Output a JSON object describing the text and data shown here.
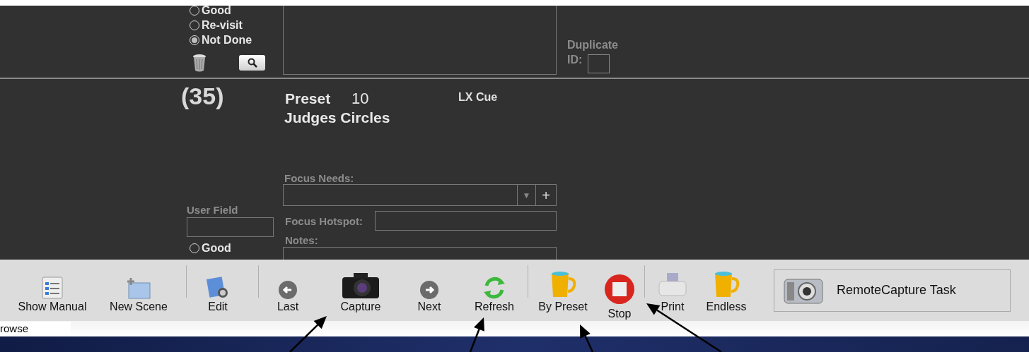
{
  "record_top": {
    "radios": [
      {
        "label": "Good",
        "selected": false
      },
      {
        "label": "Re-visit",
        "selected": false
      },
      {
        "label": "Not Done",
        "selected": true
      }
    ],
    "duplicate_label": "Duplicate",
    "id_label": "ID:"
  },
  "record": {
    "number": "(35)",
    "preset_label": "Preset",
    "preset_value": "10",
    "name": "Judges Circles",
    "lx_cue_label": "LX Cue",
    "focus_needs_label": "Focus Needs:",
    "dropdown_arrow": "▼",
    "add_button": "+",
    "user_field_label": "User Field",
    "focus_hotspot_label": "Focus Hotspot:",
    "notes_label": "Notes:",
    "radios": [
      {
        "label": "Good",
        "selected": false
      }
    ]
  },
  "toolbar": {
    "items": [
      {
        "kind": "button",
        "label": "Show Manual"
      },
      {
        "kind": "button",
        "label": "New Scene"
      },
      {
        "kind": "separator"
      },
      {
        "kind": "button",
        "label": "Edit"
      },
      {
        "kind": "separator"
      },
      {
        "kind": "button",
        "label": "Last"
      },
      {
        "kind": "button",
        "label": "Capture"
      },
      {
        "kind": "button",
        "label": "Next"
      },
      {
        "kind": "button",
        "label": "Refresh"
      },
      {
        "kind": "separator"
      },
      {
        "kind": "button",
        "label": "By Preset"
      },
      {
        "kind": "button",
        "label": "Stop"
      },
      {
        "kind": "separator"
      },
      {
        "kind": "button",
        "label": "Print"
      },
      {
        "kind": "button",
        "label": "Endless"
      }
    ],
    "task_button": "RemoteCapture Task"
  },
  "status_bar": {
    "mode": "rowse"
  }
}
